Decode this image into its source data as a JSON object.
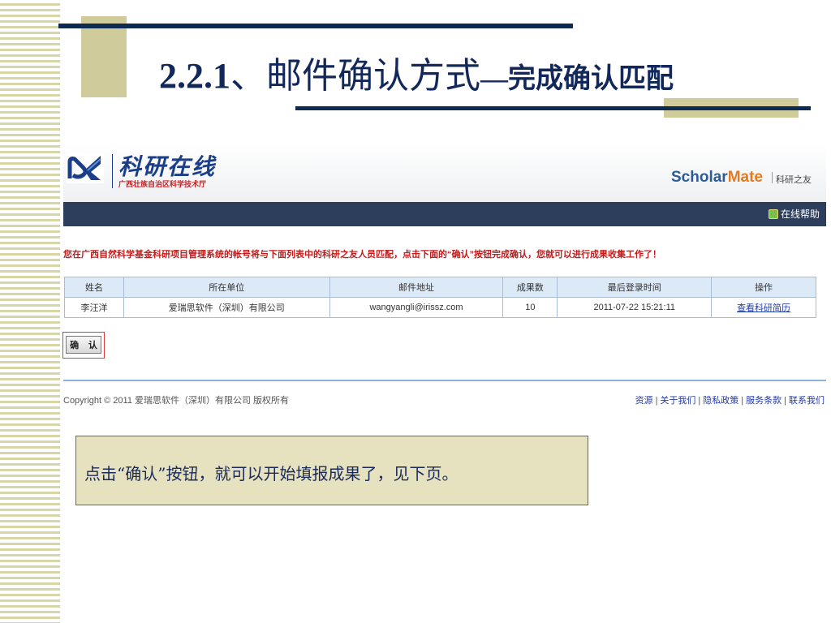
{
  "slide": {
    "title_num": "2.2.1",
    "title_main": "、邮件确认方式",
    "title_sub": "—完成确认匹配"
  },
  "header": {
    "logo_cn": "科研在线",
    "logo_sub": "广西壮族自治区科学技术厅",
    "brand_scholar": "ScholarMate",
    "brand_sub": "科研之友"
  },
  "navbar": {
    "help_label": "在线帮助"
  },
  "notice": "您在广西自然科学基金科研项目管理系统的帐号将与下面列表中的科研之友人员匹配，点击下面的“确认”按钮完成确认，您就可以进行成果收集工作了！",
  "table": {
    "headers": [
      "姓名",
      "所在单位",
      "邮件地址",
      "成果数",
      "最后登录时间",
      "操作"
    ],
    "rows": [
      [
        "李汪洋",
        "爱瑞思软件（深圳）有限公司",
        "wangyangli@irissz.com",
        "10",
        "2011-07-22 15:21:11",
        "查看科研简历"
      ]
    ]
  },
  "confirm_button": "确 认",
  "footer": {
    "copyright": "Copyright © 2011 爱瑞思软件（深圳）有限公司  版权所有",
    "links": [
      "资源",
      "关于我们",
      "隐私政策",
      "服务条款",
      "联系我们"
    ]
  },
  "callout": "点击“确认”按钮，就可以开始填报成果了，见下页。",
  "colors": {
    "title": "#12275a",
    "navbar": "#2c3e5c",
    "notice": "#c41a1a",
    "accent_stripe": "#cfcb9a"
  }
}
